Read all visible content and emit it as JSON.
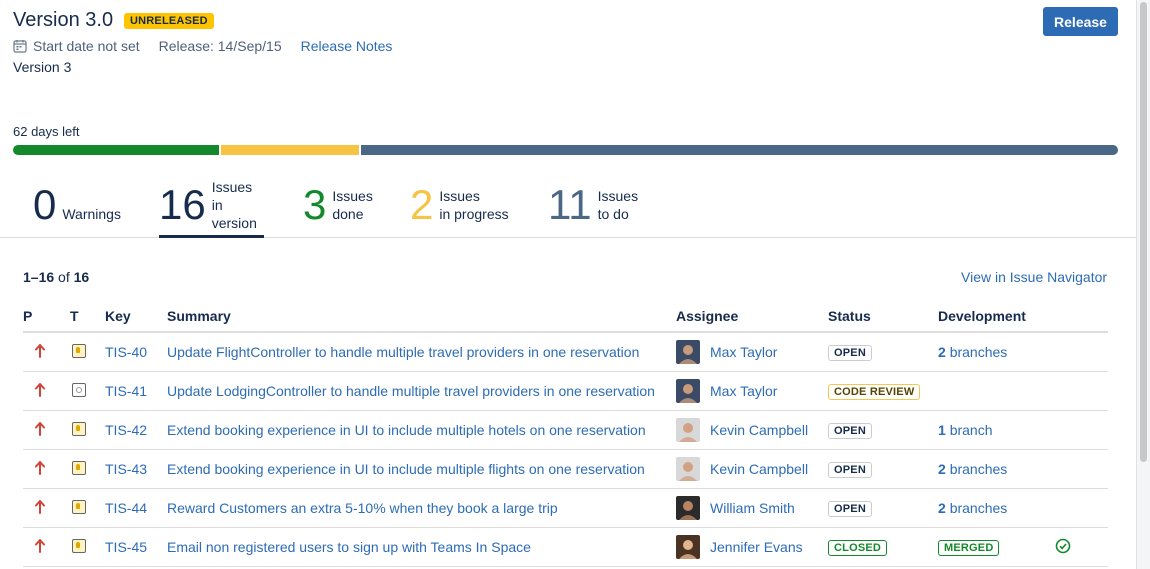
{
  "header": {
    "title": "Version 3.0",
    "badge": "UNRELEASED",
    "release_button": "Release",
    "start_date": "Start date not set",
    "release_date": "Release: 14/Sep/15",
    "release_notes_link": "Release Notes",
    "description": "Version 3"
  },
  "progress": {
    "days_left": "62 days left",
    "done_fraction": 0.1875,
    "in_progress_fraction": 0.125,
    "todo_fraction": 0.6875,
    "colors": {
      "done": "#14892C",
      "in_progress": "#F6C342",
      "todo": "#4A6785"
    }
  },
  "stats": [
    {
      "number": "0",
      "label_line1": "",
      "label_line2": "Warnings",
      "color": "#172B4D"
    },
    {
      "number": "16",
      "label_line1": "Issues in",
      "label_line2": "version",
      "color": "#172B4D"
    },
    {
      "number": "3",
      "label_line1": "Issues",
      "label_line2": "done",
      "color": "#14892C"
    },
    {
      "number": "2",
      "label_line1": "Issues",
      "label_line2": "in progress",
      "color": "#F6C342"
    },
    {
      "number": "11",
      "label_line1": "Issues",
      "label_line2": "to do",
      "color": "#4A6785"
    }
  ],
  "issues_summary": {
    "range": "1–16",
    "of": "of",
    "total": "16",
    "navigator_link": "View in Issue Navigator"
  },
  "table": {
    "columns": [
      "P",
      "T",
      "Key",
      "Summary",
      "Assignee",
      "Status",
      "Development"
    ],
    "rows": [
      {
        "priority_icon": "arrow-up-icon",
        "type_icon": "improvement-icon",
        "key": "TIS-40",
        "summary": "Update FlightController to handle multiple travel providers in one reservation",
        "assignee": "Max Taylor",
        "status": "OPEN",
        "dev_count": "2",
        "dev_label": "branches"
      },
      {
        "priority_icon": "arrow-up-icon",
        "type_icon": "review-icon",
        "key": "TIS-41",
        "summary": "Update LodgingController to handle multiple travel providers in one reservation",
        "assignee": "Max Taylor",
        "status": "CODE REVIEW",
        "dev_count": "",
        "dev_label": ""
      },
      {
        "priority_icon": "arrow-up-icon",
        "type_icon": "improvement-icon",
        "key": "TIS-42",
        "summary": "Extend booking experience in UI to include multiple hotels on one reservation",
        "assignee": "Kevin Campbell",
        "status": "OPEN",
        "dev_count": "1",
        "dev_label": "branch"
      },
      {
        "priority_icon": "arrow-up-icon",
        "type_icon": "improvement-icon",
        "key": "TIS-43",
        "summary": "Extend booking experience in UI to include multiple flights on one reservation",
        "assignee": "Kevin Campbell",
        "status": "OPEN",
        "dev_count": "2",
        "dev_label": "branches"
      },
      {
        "priority_icon": "arrow-up-icon",
        "type_icon": "improvement-icon",
        "key": "TIS-44",
        "summary": "Reward Customers an extra 5-10% when they book a large trip",
        "assignee": "William Smith",
        "status": "OPEN",
        "dev_count": "2",
        "dev_label": "branches"
      },
      {
        "priority_icon": "arrow-up-icon",
        "type_icon": "improvement-icon",
        "key": "TIS-45",
        "summary": "Email non registered users to sign up with Teams In Space",
        "assignee": "Jennifer Evans",
        "status": "CLOSED",
        "dev_count": "",
        "dev_label": "",
        "dev_badge": "MERGED",
        "dev_check": "check-circle-icon"
      }
    ]
  }
}
